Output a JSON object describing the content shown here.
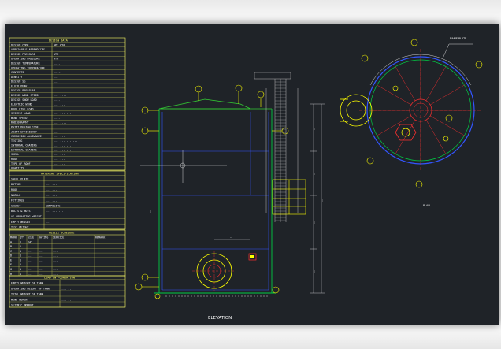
{
  "design_data": {
    "title": "DESIGN DATA",
    "rows": [
      [
        "DESIGN CODE",
        "API 650 ..."
      ],
      [
        "APPLICABLE APPENDICES",
        "...."
      ],
      [
        "DESIGN PRESSURE",
        "ATM"
      ],
      [
        "OPERATING PRESSURE",
        "ATM"
      ],
      [
        "DESIGN TEMPERATURE",
        "...."
      ],
      [
        "OPERATING TEMPERATURE",
        "...."
      ],
      [
        "CONTENTS",
        "....."
      ],
      [
        "DENSITY",
        "..."
      ],
      [
        "DESIGN SG",
        "..."
      ],
      [
        "FLUID PEAK",
        "..."
      ],
      [
        "DESIGN PRESSURE",
        "..."
      ],
      [
        "DESIGN WIND SPEED",
        "... ...."
      ],
      [
        "DESIGN SNOW LOAD",
        "...."
      ],
      [
        "ELECTRIC WIND",
        "... ..."
      ],
      [
        "ROOF LIVE LOAD",
        "... ...."
      ],
      [
        "SEISMIC LOAD",
        "... ... ..."
      ],
      [
        "WIND SPEED",
        "...."
      ],
      [
        "RADIOGRAPHY",
        "... ...."
      ],
      [
        "PAINT DESIGN CODE",
        "... ... ... ..."
      ],
      [
        "JOINT EFFICIENCY",
        "..."
      ],
      [
        "CORROSION ALLOWANCE",
        "... ..."
      ],
      [
        "TESTING",
        "... ... ... ..."
      ],
      [
        "INTERNAL COATING",
        "... ... ..."
      ],
      [
        "EXTERNAL COATING",
        "... ... ..."
      ],
      [
        "SHELL",
        "... ..."
      ],
      [
        "ROOF",
        "... ..."
      ],
      [
        "TYPE OF ROOF",
        "... ..."
      ],
      [
        "QUANTITY",
        "..."
      ]
    ]
  },
  "material_spec": {
    "title": "MATERIAL SPECIFICATION",
    "rows": [
      [
        "SHELL PLATE",
        "... ..."
      ],
      [
        "BOTTOM",
        "... ..."
      ],
      [
        "ROOF",
        "... ..."
      ],
      [
        "NOZZLE",
        "... ..."
      ],
      [
        "FITTINGS",
        "... ..."
      ],
      [
        "GASKET",
        "COMPOSITE"
      ],
      [
        "BOLTS & NUTS",
        "... ... ..."
      ],
      [
        "AS OPERATING WEIGHT",
        "..."
      ],
      [
        "EMPTY WEIGHT",
        "..."
      ],
      [
        "TEST WEIGHT",
        "..."
      ]
    ]
  },
  "nozzle_schedule": {
    "title": "NOZZLE SCHEDULE",
    "headers": [
      "MARK",
      "QTY",
      "SIZE",
      "RATING",
      "SERVICE",
      "REMARK"
    ],
    "rows": [
      [
        "A",
        "1",
        "24\"",
        "...",
        "...",
        ""
      ],
      [
        "B",
        "1",
        "...",
        "...",
        "...",
        ""
      ],
      [
        "C",
        "1",
        "...",
        "...",
        "...",
        ""
      ],
      [
        "D",
        "1",
        "...",
        "...",
        "...",
        ""
      ],
      [
        "E",
        "1",
        "...",
        "...",
        "...",
        ""
      ],
      [
        "F",
        "1",
        "...",
        "...",
        "...",
        ""
      ],
      [
        "G",
        "1",
        "...",
        "...",
        "...",
        ""
      ],
      [
        "H",
        "1",
        "...",
        "...",
        "...",
        ""
      ]
    ]
  },
  "load_table": {
    "title": "LOAD ON FOUNDATION",
    "rows": [
      [
        "EMPTY WEIGHT OF TANK",
        "...."
      ],
      [
        "OPERATING WEIGHT OF TANK",
        "... ..."
      ],
      [
        "TOTAL WEIGHT OF TANK",
        "... ..."
      ],
      [
        "WIND MOMENT",
        "... ..."
      ],
      [
        "SEISMIC MOMENT",
        "... ..."
      ]
    ]
  },
  "plan_view": {
    "name_plate_label": "NAME PLATE",
    "view_label": "PLAN"
  },
  "elevation_view": {
    "view_label": "ELEVATION"
  },
  "colors": {
    "background": "#1f2328",
    "table_border": "#ffff66",
    "shell": "#00cc44",
    "inner": "#3355ff",
    "roof": "#33cc33",
    "ladder": "#bbbbbb",
    "nozzle": "#ffff00",
    "centerline": "#ff3030",
    "dimension": "#ffffff"
  }
}
